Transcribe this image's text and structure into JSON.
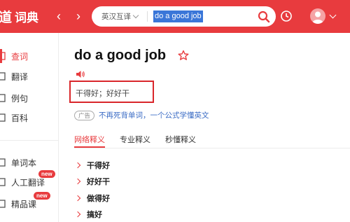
{
  "app": {
    "logo_mark": "道",
    "logo_text": "词典"
  },
  "search": {
    "lang": "英汉互译",
    "query": "do a good job"
  },
  "sidebar": {
    "items": [
      {
        "label": "查词",
        "icon": "search-book-icon"
      },
      {
        "label": "翻译",
        "icon": "translate-icon"
      },
      {
        "label": "例句",
        "icon": "sentence-icon"
      },
      {
        "label": "百科",
        "icon": "encyclopedia-icon"
      },
      {
        "label": "单词本",
        "icon": "wordbook-icon"
      },
      {
        "label": "人工翻译",
        "icon": "human-translate-icon",
        "badge": "new"
      },
      {
        "label": "精品课",
        "icon": "course-icon",
        "badge": "new"
      }
    ]
  },
  "entry": {
    "word": "do a good job",
    "brief_meaning": "干得好；好好干",
    "ad_badge": "广告",
    "ad_text": "不再死背单词，一个公式学懂英文"
  },
  "tabs": [
    "网络释义",
    "专业释义",
    "秒懂释义"
  ],
  "definitions": [
    "干得好",
    "好好干",
    "做得好",
    "搞好"
  ],
  "colors": {
    "brand": "#e83b3e",
    "link": "#3b6cc5",
    "highlight_box": "#d9262b"
  }
}
